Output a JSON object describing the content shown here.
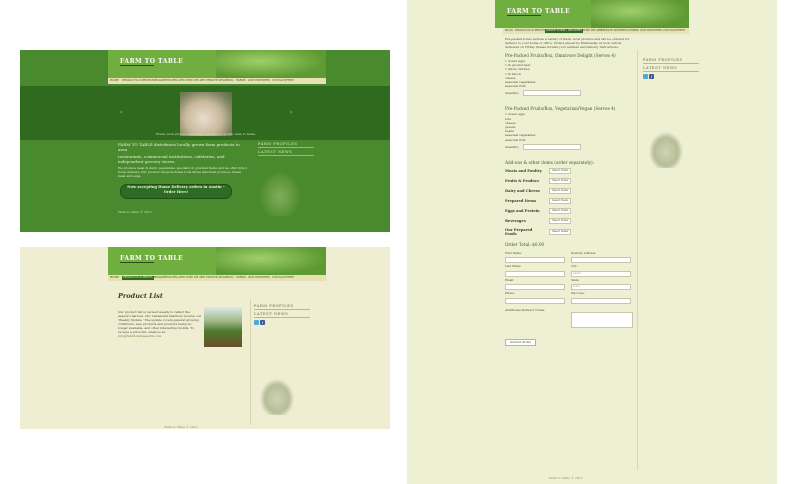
{
  "brand": {
    "logo_text": "FARM TO TABLE"
  },
  "nav_items": [
    "HOME",
    "PRODUCTS & PRICES",
    "MEDIA/PRESS RELATED",
    "WHO WE ARE",
    "PRIVATE SHOPPING",
    "FARMS",
    "OUR PARTNERS",
    "CONTACT/FREE"
  ],
  "nav_items_c": [
    "BLOG",
    "PRODUCTS & PRICES",
    "ORDER FORM / DELIVERY",
    "WHO WE ARE",
    "PRIVATE SHOPPING",
    "FARMS",
    "OUR PARTNERS",
    "CONTACT/FREE"
  ],
  "panel_a": {
    "slider_caption": "Fresh, local produce delivered — in season, grown close to home.",
    "intro_title": "FARM TO TABLE distributes locally grown farm products to area",
    "intro_body": "restaurants, commercial institutions, cafeterias, and independent grocery stores.",
    "para2": "We produce meat & dairy, vegetables, specialty & gourmet items and we offer direct home delivery. Our product range includes local farms and fresh produce, bread, meat and eggs.",
    "cta_label": "Now accepting Home Delivery orders in Austin – Order Here!",
    "side_title_1": "FARM PROFILES",
    "side_title_2": "LATEST NEWS",
    "footer": "Farm to Table © 2012"
  },
  "panel_b": {
    "title": "Product List",
    "intro": "Our product list is revised weekly to reflect the season's harvest. Our restaurant members receive our 'Weekly Update.' The update covers general growing conditions, new products and products being no longer available, and other interesting tid-bits. To receive a price list, email us at:",
    "email": "info@farmtotableaustin.com",
    "side_title_1": "FARM PROFILES",
    "side_title_2": "LATEST NEWS",
    "footer": "Farm to Table © 2012"
  },
  "panel_c": {
    "intro": "Pre-packed boxes include a variety of fresh, local produce and can be ordered for delivery to your home or office. Orders placed by Wednesday at noon will be delivered on Friday. Please include your address and delivery instructions.",
    "section1_title": "Pre-Packed Fruits/Box, Omnivore Delight (Serves 4)",
    "section1_lines": [
      "1 dozen eggs",
      "1 lb ground beef",
      "1 whole chicken",
      "1 lb bacon",
      "cheese",
      "seasonal vegetables",
      "seasonal fruit"
    ],
    "section2_title": "Pre-Packed Fruits/Box, Vegetarian/Vegan (Serves 4)",
    "section2_lines": [
      "1 dozen eggs",
      "tofu",
      "cheese",
      "greens",
      "beans",
      "seasonal vegetables",
      "seasonal fruit"
    ],
    "quantity_label": "Quantity:",
    "categories_title": "Add-ons & other items (order separately):",
    "categories": [
      {
        "label": "Meats and Poultry",
        "select": "Select Items"
      },
      {
        "label": "Fruits & Produce",
        "select": "Select Items"
      },
      {
        "label": "Dairy and Cheese",
        "select": "Select Items"
      },
      {
        "label": "Prepared Items",
        "select": "Select Items"
      },
      {
        "label": "Eggs and Protein",
        "select": "Select Items"
      },
      {
        "label": "Beverages",
        "select": "Select Items"
      },
      {
        "label": "Our Prepared Foods",
        "select": "Select Items"
      }
    ],
    "order_title": "Order Total: $0.00",
    "form": {
      "first_name": "First Name:",
      "last_name": "Last Name:",
      "email": "Email:",
      "phone": "Phone:",
      "delivery_address": "Delivery Address:",
      "city": "City:",
      "state": "State:",
      "zip": "Zip Code:",
      "city_value": "Austin",
      "state_value": "Texas"
    },
    "notes_label": "Additional Delivery Notes:",
    "submit_label": "Submit Order",
    "side_title_1": "FARM PROFILES",
    "side_title_2": "LATEST NEWS",
    "footer": "Farm to Table © 2012"
  }
}
